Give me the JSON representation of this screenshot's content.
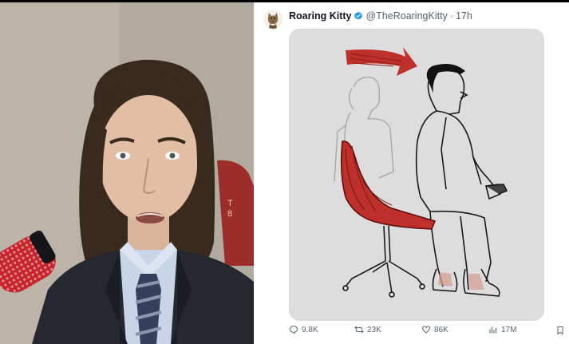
{
  "tweet": {
    "display_name": "Roaring Kitty",
    "handle": "@TheRoaringKitty",
    "separator": "·",
    "time": "17h",
    "avatar_icon": "kitten-icon",
    "verified_color": "#1d9bf0",
    "media": {
      "description_icon": "chair-recline-illustration",
      "accent_color": "#c0302a"
    },
    "stats": {
      "replies": "9.8K",
      "retweets": "23K",
      "likes": "86K",
      "views": "17M"
    }
  },
  "video": {
    "chair_text": "T\n8"
  }
}
